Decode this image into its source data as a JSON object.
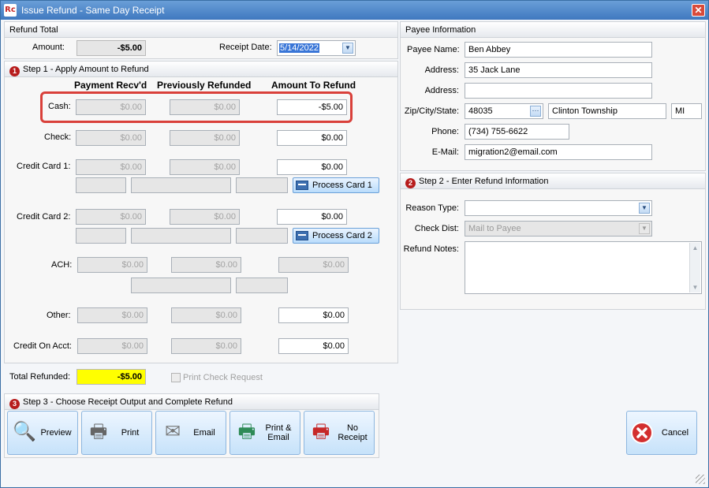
{
  "window": {
    "title": "Issue Refund - Same Day Receipt",
    "logo_text": "Rc"
  },
  "refund_total": {
    "header": "Refund Total",
    "amount_label": "Amount:",
    "amount_value": "-$5.00",
    "receipt_date_label": "Receipt Date:",
    "receipt_date_value": "5/14/2022"
  },
  "step1": {
    "number": "1",
    "header": "Step 1 - Apply Amount to Refund",
    "columns": [
      "Payment Recv'd",
      "Previously Refunded",
      "Amount To Refund"
    ],
    "cash": {
      "label": "Cash:",
      "received": "$0.00",
      "prev": "$0.00",
      "refund": "-$5.00"
    },
    "check": {
      "label": "Check:",
      "received": "$0.00",
      "prev": "$0.00",
      "refund": "$0.00"
    },
    "cc1": {
      "label": "Credit Card 1:",
      "received": "$0.00",
      "prev": "$0.00",
      "refund": "$0.00",
      "button": "Process Card 1"
    },
    "cc2": {
      "label": "Credit Card 2:",
      "received": "$0.00",
      "prev": "$0.00",
      "refund": "$0.00",
      "button": "Process Card 2"
    },
    "ach": {
      "label": "ACH:",
      "received": "$0.00",
      "prev": "$0.00",
      "refund": "$0.00"
    },
    "other": {
      "label": "Other:",
      "received": "$0.00",
      "prev": "$0.00",
      "refund": "$0.00"
    },
    "credit_on_acct": {
      "label": "Credit On Acct:",
      "received": "$0.00",
      "prev": "$0.00",
      "refund": "$0.00"
    },
    "total_label": "Total Refunded:",
    "total_value": "-$5.00",
    "print_check_label": "Print Check Request"
  },
  "payee": {
    "header": "Payee Information",
    "name_label": "Payee Name:",
    "name": "Ben Abbey",
    "address_label": "Address:",
    "address1": "35 Jack Lane",
    "address2": "",
    "zip_label": "Zip/City/State:",
    "zip": "48035",
    "city": "Clinton Township",
    "state": "MI",
    "phone_label": "Phone:",
    "phone": "(734) 755-6622",
    "email_label": "E-Mail:",
    "email": "migration2@email.com"
  },
  "step2": {
    "number": "2",
    "header": "Step 2 - Enter Refund Information",
    "reason_label": "Reason Type:",
    "reason_value": "",
    "check_dist_label": "Check Dist:",
    "check_dist_value": "Mail to Payee",
    "notes_label": "Refund Notes:",
    "notes_value": ""
  },
  "step3": {
    "number": "3",
    "header": "Step 3 - Choose Receipt Output and Complete Refund",
    "buttons": [
      {
        "label": "Preview",
        "icon": "magnifier-icon"
      },
      {
        "label": "Print",
        "icon": "printer-icon"
      },
      {
        "label": "Email",
        "icon": "envelope-icon"
      },
      {
        "label": "Print &\nEmail",
        "icon": "printer-globe-icon"
      },
      {
        "label": "No\nReceipt",
        "icon": "printer-cancel-icon"
      }
    ],
    "cancel": {
      "label": "Cancel",
      "icon": "cancel-icon"
    }
  },
  "colors": {
    "highlight": "#d9403a",
    "total_bg": "#ffff00",
    "title_bar": "#3f78bf"
  }
}
